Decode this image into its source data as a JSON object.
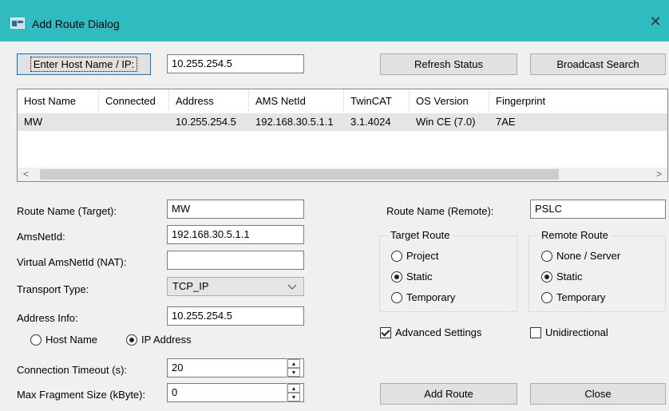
{
  "window": {
    "title": "Add Route Dialog",
    "close_glyph": "✕",
    "title_color": "#2fbcc0"
  },
  "top": {
    "enter_host_label": "Enter Host Name / IP:",
    "host_value": "10.255.254.5",
    "refresh_label": "Refresh Status",
    "broadcast_label": "Broadcast Search"
  },
  "table": {
    "columns": [
      "Host Name",
      "Connected",
      "Address",
      "AMS NetId",
      "TwinCAT",
      "OS Version",
      "Fingerprint"
    ],
    "rows": [
      {
        "host": "MW",
        "connected": "",
        "address": "10.255.254.5",
        "netid": "192.168.30.5.1.1",
        "twincat": "3.1.4024",
        "os": "Win CE (7.0)",
        "fingerprint": "7AE"
      }
    ],
    "scroll_left": "<",
    "scroll_right": ">"
  },
  "form": {
    "route_name_label": "Route Name (Target):",
    "route_name_value": "MW",
    "amsnetid_label": "AmsNetId:",
    "amsnetid_value": "192.168.30.5.1.1",
    "virtual_label": "Virtual AmsNetId (NAT):",
    "virtual_value": "",
    "transport_label": "Transport Type:",
    "transport_value": "TCP_IP",
    "address_label": "Address Info:",
    "address_value": "10.255.254.5",
    "host_name_radio": "Host Name",
    "ip_address_radio": "IP Address",
    "timeout_label": "Connection Timeout (s):",
    "timeout_value": "20",
    "fragment_label": "Max Fragment Size (kByte):",
    "fragment_value": "0"
  },
  "remote": {
    "route_name_remote_label": "Route Name (Remote):",
    "route_name_remote_value": "PSLC",
    "target_route_title": "Target Route",
    "target_options": [
      "Project",
      "Static",
      "Temporary"
    ],
    "target_selected": "Static",
    "remote_route_title": "Remote Route",
    "remote_options": [
      "None / Server",
      "Static",
      "Temporary"
    ],
    "remote_selected": "Static",
    "advanced_label": "Advanced Settings",
    "advanced_checked": true,
    "unidirectional_label": "Unidirectional",
    "unidirectional_checked": false
  },
  "actions": {
    "add_route_label": "Add Route",
    "close_label": "Close"
  },
  "icons": {
    "app": "app-window-icon",
    "chevron": "chevron-down-icon",
    "spin_up": "spin-up-icon",
    "spin_down": "spin-down-icon"
  }
}
